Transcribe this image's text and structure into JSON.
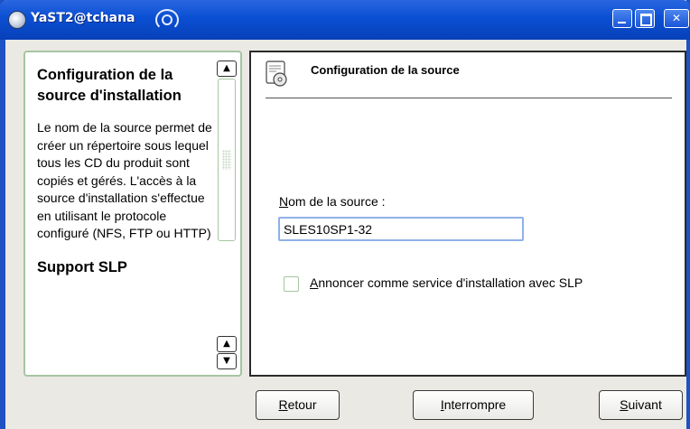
{
  "window": {
    "title": "YaST2@tchana",
    "icon": "yast-icon"
  },
  "help": {
    "heading1": "Configuration de la source d'installation",
    "paragraph": "Le nom de la source permet de créer un répertoire sous lequel tous les CD du produit sont copiés et gérés. L'accès à la source d'installation s'effectue en utilisant le protocole configuré (NFS, FTP ou HTTP)",
    "heading2": "Support SLP",
    "cut_text": "SLP ..."
  },
  "main": {
    "title": "Configuration de la source",
    "source_name": {
      "label_mnemonic": "N",
      "label_rest": "om de la source :",
      "value": "SLES10SP1-32"
    },
    "slp_checkbox": {
      "checked": false,
      "label_mnemonic": "A",
      "label_rest": "nnoncer comme service d'installation avec SLP"
    }
  },
  "buttons": {
    "back": {
      "mnemonic": "R",
      "rest": "etour"
    },
    "abort": {
      "mnemonic": "I",
      "rest": "nterrompre"
    },
    "next": {
      "mnemonic": "S",
      "rest": "uivant"
    }
  },
  "colors": {
    "titlebar": "#0a4fd3",
    "frame_green": "#a5c6a0",
    "input_border": "#8fb1e6",
    "window_bg": "#ebe9e4"
  }
}
